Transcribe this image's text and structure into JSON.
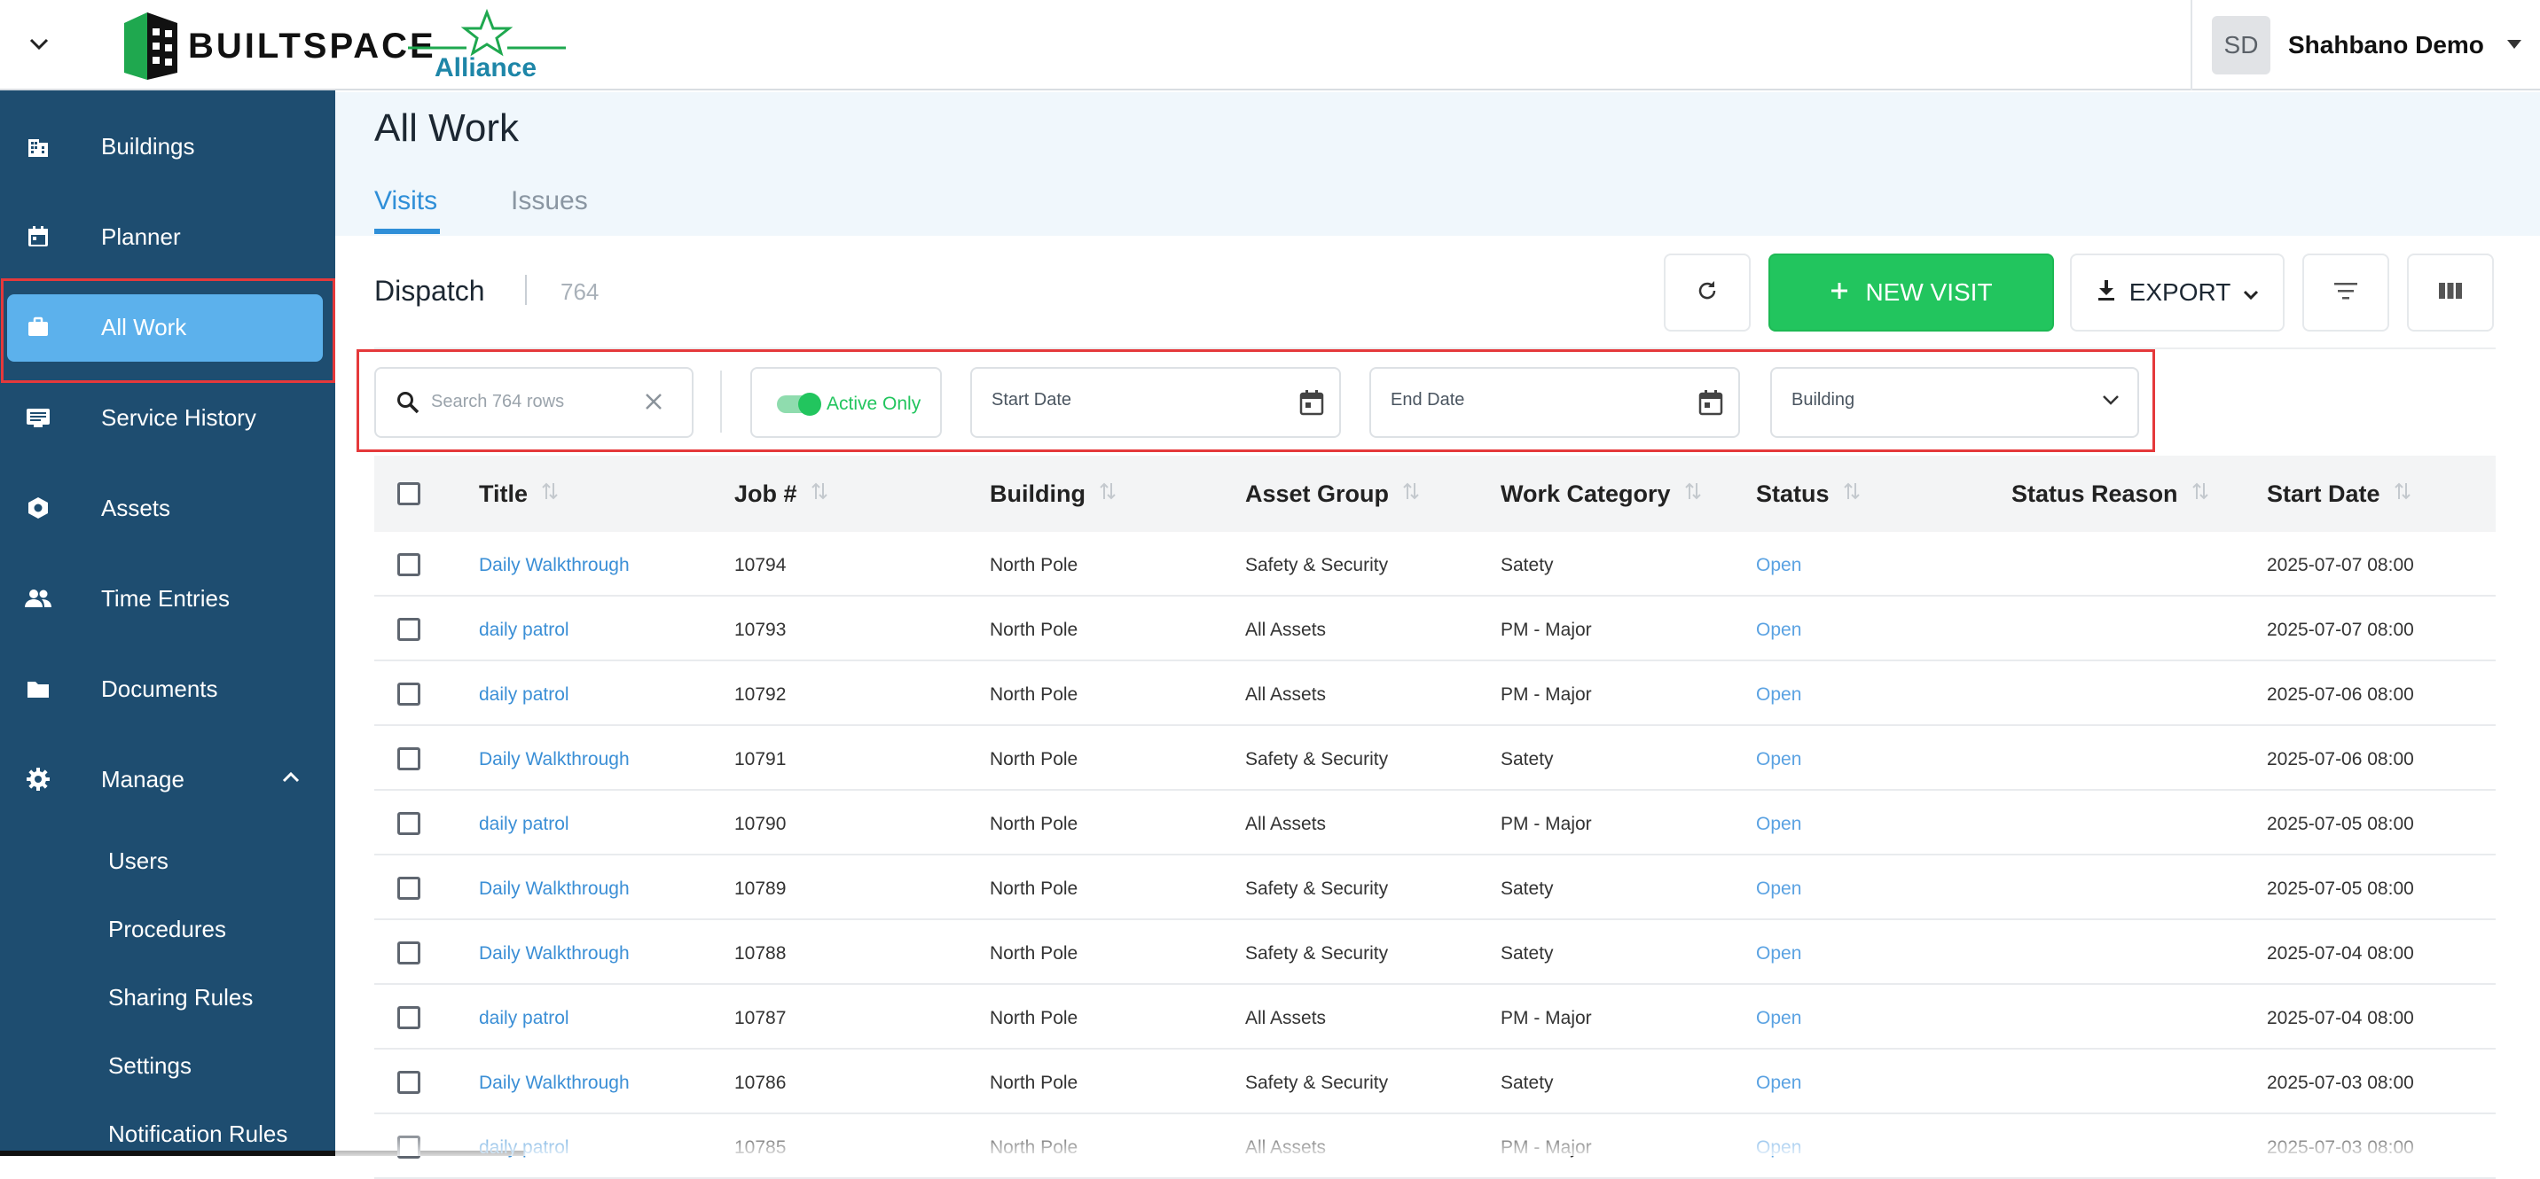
{
  "app": {
    "brand_primary": "BUILT",
    "brand_secondary": "SPACE",
    "partner_logo_text": "Alliance",
    "colors": {
      "sidebar": "#1e4d70",
      "active_nav": "#5cb1ec",
      "accent": "#22c55e",
      "link": "#3b8fd6",
      "highlight": "#e5393b"
    }
  },
  "user": {
    "initials": "SD",
    "name": "Shahbano Demo"
  },
  "sidebar": {
    "items": [
      {
        "label": "Buildings",
        "icon": "building-icon"
      },
      {
        "label": "Planner",
        "icon": "calendar-icon"
      },
      {
        "label": "All Work",
        "icon": "briefcase-icon",
        "active": true
      },
      {
        "label": "Service History",
        "icon": "list-box-icon"
      },
      {
        "label": "Assets",
        "icon": "hexagon-icon"
      },
      {
        "label": "Time Entries",
        "icon": "people-icon"
      },
      {
        "label": "Documents",
        "icon": "folder-icon"
      },
      {
        "label": "Manage",
        "icon": "gear-icon",
        "expanded": true
      }
    ],
    "manage_items": [
      "Users",
      "Procedures",
      "Sharing Rules",
      "Settings",
      "Notification Rules"
    ]
  },
  "page": {
    "title": "All Work",
    "tabs": [
      {
        "label": "Visits",
        "active": true
      },
      {
        "label": "Issues",
        "active": false
      }
    ],
    "section_title": "Dispatch",
    "count": "764"
  },
  "toolbar": {
    "new_visit_label": "NEW VISIT",
    "export_label": "EXPORT"
  },
  "filters": {
    "search_placeholder": "Search 764 rows",
    "active_only_label": "Active Only",
    "active_only": true,
    "start_date_label": "Start Date",
    "end_date_label": "End Date",
    "building_label": "Building"
  },
  "table": {
    "columns": [
      "Title",
      "Job #",
      "Building",
      "Asset Group",
      "Work Category",
      "Status",
      "Status Reason",
      "Start Date"
    ],
    "rows": [
      {
        "title": "Daily Walkthrough",
        "job": "10794",
        "building": "North Pole",
        "asset_group": "Safety & Security",
        "category": "Satety",
        "status": "Open",
        "reason": "",
        "start": "2025-07-07 08:00"
      },
      {
        "title": "daily patrol",
        "job": "10793",
        "building": "North Pole",
        "asset_group": "All Assets",
        "category": "PM - Major",
        "status": "Open",
        "reason": "",
        "start": "2025-07-07 08:00"
      },
      {
        "title": "daily patrol",
        "job": "10792",
        "building": "North Pole",
        "asset_group": "All Assets",
        "category": "PM - Major",
        "status": "Open",
        "reason": "",
        "start": "2025-07-06 08:00"
      },
      {
        "title": "Daily Walkthrough",
        "job": "10791",
        "building": "North Pole",
        "asset_group": "Safety & Security",
        "category": "Satety",
        "status": "Open",
        "reason": "",
        "start": "2025-07-06 08:00"
      },
      {
        "title": "daily patrol",
        "job": "10790",
        "building": "North Pole",
        "asset_group": "All Assets",
        "category": "PM - Major",
        "status": "Open",
        "reason": "",
        "start": "2025-07-05 08:00"
      },
      {
        "title": "Daily Walkthrough",
        "job": "10789",
        "building": "North Pole",
        "asset_group": "Safety & Security",
        "category": "Satety",
        "status": "Open",
        "reason": "",
        "start": "2025-07-05 08:00"
      },
      {
        "title": "Daily Walkthrough",
        "job": "10788",
        "building": "North Pole",
        "asset_group": "Safety & Security",
        "category": "Satety",
        "status": "Open",
        "reason": "",
        "start": "2025-07-04 08:00"
      },
      {
        "title": "daily patrol",
        "job": "10787",
        "building": "North Pole",
        "asset_group": "All Assets",
        "category": "PM - Major",
        "status": "Open",
        "reason": "",
        "start": "2025-07-04 08:00"
      },
      {
        "title": "Daily Walkthrough",
        "job": "10786",
        "building": "North Pole",
        "asset_group": "Safety & Security",
        "category": "Satety",
        "status": "Open",
        "reason": "",
        "start": "2025-07-03 08:00"
      },
      {
        "title": "daily patrol",
        "job": "10785",
        "building": "North Pole",
        "asset_group": "All Assets",
        "category": "PM - Major",
        "status": "Open",
        "reason": "",
        "start": "2025-07-03 08:00"
      }
    ]
  }
}
